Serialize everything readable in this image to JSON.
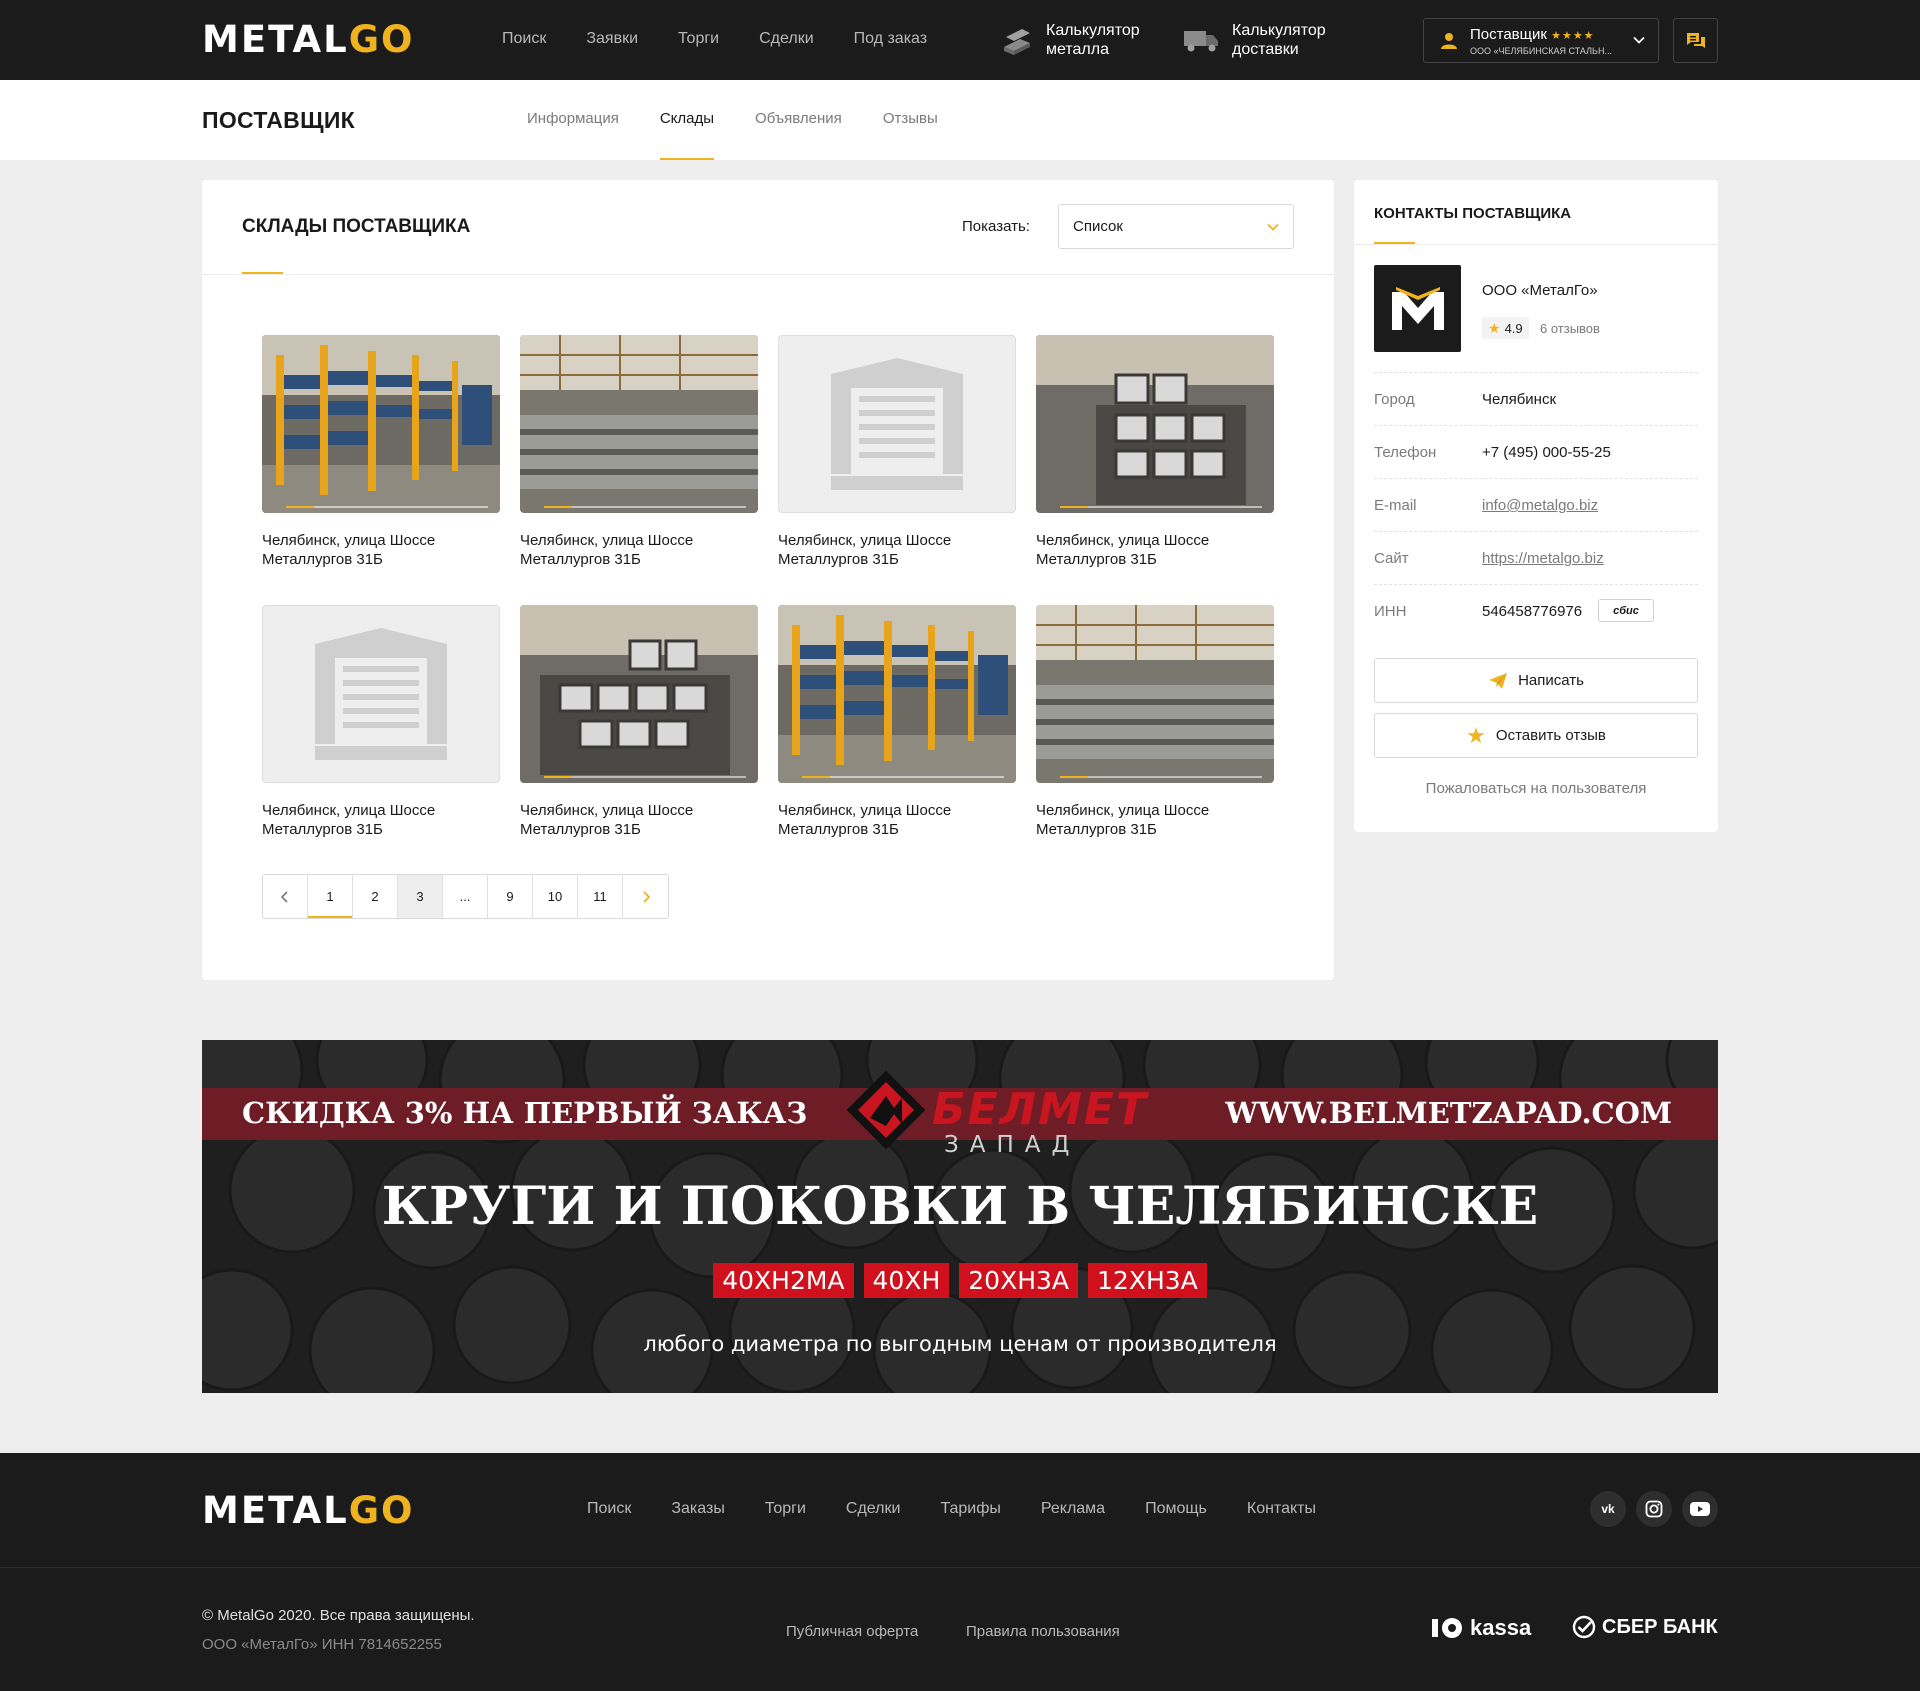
{
  "header": {
    "logo": {
      "part1": "METAL",
      "part2": "GO"
    },
    "nav": [
      "Поиск",
      "Заявки",
      "Торги",
      "Сделки",
      "Под заказ"
    ],
    "calc_metal": {
      "line1": "Калькулятор",
      "line2": "металла"
    },
    "calc_delivery": {
      "line1": "Калькулятор",
      "line2": "доставки"
    },
    "user": {
      "role": "Поставщик",
      "stars": "★★★★",
      "company": "ООО «ЧЕЛЯБИНСКАЯ СТАЛЬН..."
    }
  },
  "subheader": {
    "title": "ПОСТАВЩИК",
    "tabs": [
      {
        "label": "Информация",
        "active": false
      },
      {
        "label": "Склады",
        "active": true
      },
      {
        "label": "Объявления",
        "active": false
      },
      {
        "label": "Отзывы",
        "active": false
      }
    ]
  },
  "warehouses": {
    "title": "СКЛАДЫ ПОСТАВЩИКА",
    "show_label": "Показать:",
    "view_select": "Список",
    "items": [
      {
        "caption": "Челябинск, улица Шоссе Металлургов 31Б",
        "image": "warehouse-racks-photo"
      },
      {
        "caption": "Челябинск, улица Шоссе Металлургов 31Б",
        "image": "warehouse-hall-photo"
      },
      {
        "caption": "Челябинск, улица Шоссе Металлургов 31Б",
        "image": "placeholder"
      },
      {
        "caption": "Челябинск, улица Шоссе Металлургов 31Б",
        "image": "channel-steel-photo"
      },
      {
        "caption": "Челябинск, улица Шоссе Металлургов 31Б",
        "image": "placeholder"
      },
      {
        "caption": "Челябинск, улица Шоссе Металлургов 31Б",
        "image": "channel-steel-photo"
      },
      {
        "caption": "Челябинск, улица Шоссе Металлургов 31Б",
        "image": "warehouse-racks-photo"
      },
      {
        "caption": "Челябинск, улица Шоссе Металлургов 31Б",
        "image": "warehouse-hall-photo"
      }
    ],
    "pagination": {
      "pages": [
        "1",
        "2",
        "3",
        "...",
        "9",
        "10",
        "11"
      ],
      "current": "1",
      "highlighted": "3"
    }
  },
  "contacts": {
    "title": "КОНТАКТЫ ПОСТАВЩИКА",
    "company": "ООО «МеталГо»",
    "rating": "4.9",
    "reviews": "6 отзывов",
    "rows": [
      {
        "key": "Город",
        "value": "Челябинск"
      },
      {
        "key": "Телефон",
        "value": "+7 (495) 000-55-25"
      },
      {
        "key": "E-mail",
        "value": "info@metalgo.biz"
      },
      {
        "key": "Сайт",
        "value": "https://metalgo.biz"
      },
      {
        "key": "ИНН",
        "value": "546458776976"
      }
    ],
    "sbis_label": "сбис",
    "write_button": "Написать",
    "review_button": "Оставить отзыв",
    "complain_link": "Пожаловаться на пользователя"
  },
  "banner": {
    "left_text": "СКИДКА 3% НА ПЕРВЫЙ ЗАКАЗ",
    "right_text": "WWW.BELMETZAPAD.COM",
    "brand": "БЕЛМЕТ",
    "brand_sub": "ЗАПАД",
    "headline": "КРУГИ И ПОКОВКИ В ЧЕЛЯБИНСКЕ",
    "tags": [
      "40ХН2МА",
      "40ХН",
      "20ХН3А",
      "12ХН3А"
    ],
    "footer_text": "любого диаметра по выгодным ценам от производителя"
  },
  "footer": {
    "nav": [
      "Поиск",
      "Заказы",
      "Торги",
      "Сделки",
      "Тарифы",
      "Реклама",
      "Помощь",
      "Контакты"
    ],
    "social": [
      "vk-icon",
      "instagram-icon",
      "youtube-icon"
    ],
    "copyright": "© MetalGo 2020. Все права защищены.",
    "legal": "ООО «МеталГо» ИНН 7814652255",
    "offer_link": "Публичная оферта",
    "rules_link": "Правила пользования",
    "payment1": "kassa",
    "payment2": "СБЕР БАНК"
  },
  "colors": {
    "accent": "#f0b320",
    "dark": "#1b1b1b",
    "banner_red": "#d0101c"
  }
}
